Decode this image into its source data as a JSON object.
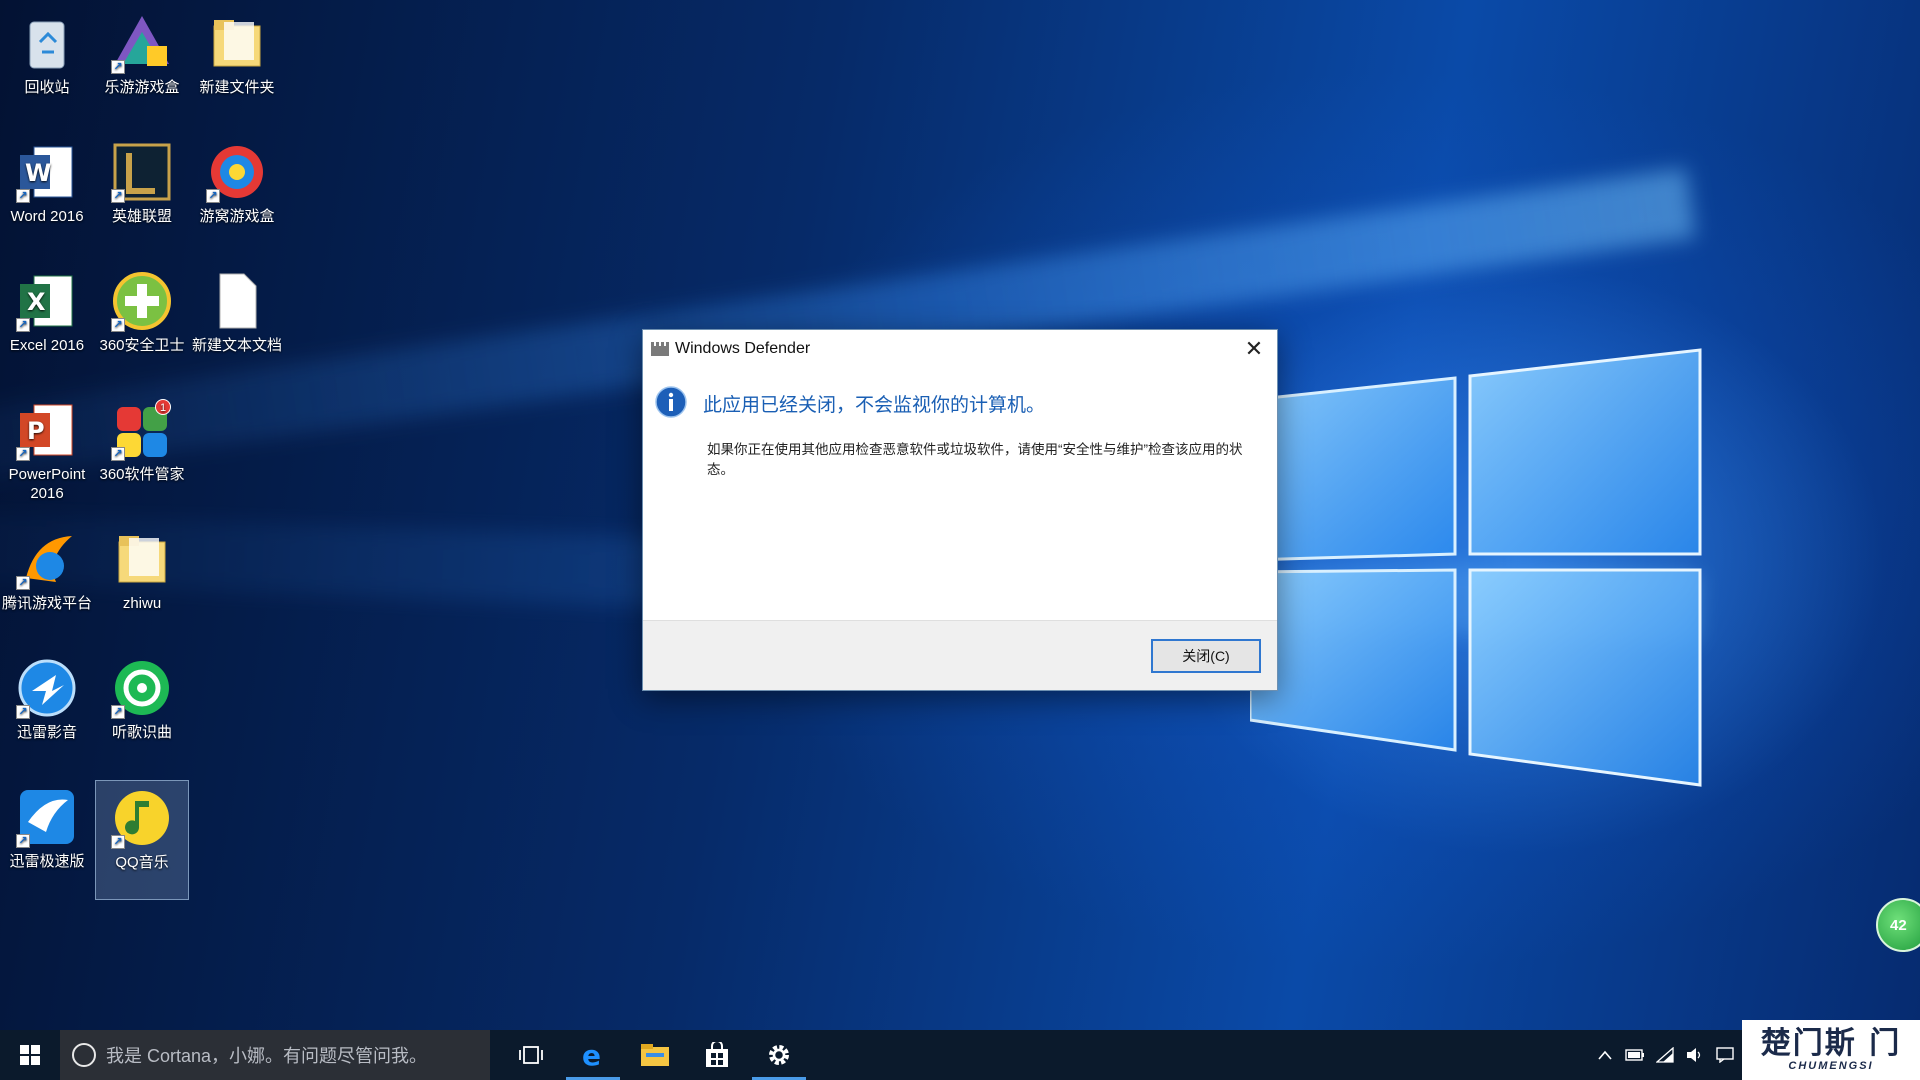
{
  "desktop": {
    "icons": [
      {
        "label": "回收站",
        "icon": "recycle-bin-icon"
      },
      {
        "label": "乐游游戏盒",
        "icon": "leyou-game-box-icon"
      },
      {
        "label": "新建文件夹",
        "icon": "folder-icon"
      },
      {
        "label": "Word 2016",
        "icon": "word-icon"
      },
      {
        "label": "英雄联盟",
        "icon": "league-of-legends-icon"
      },
      {
        "label": "游窝游戏盒",
        "icon": "youwo-game-box-icon"
      },
      {
        "label": "Excel 2016",
        "icon": "excel-icon"
      },
      {
        "label": "360安全卫士",
        "icon": "360-security-icon"
      },
      {
        "label": "新建文本文档",
        "icon": "text-document-icon"
      },
      {
        "label": "PowerPoint 2016",
        "icon": "powerpoint-icon"
      },
      {
        "label": "360软件管家",
        "icon": "360-software-manager-icon",
        "badge": "1"
      },
      {
        "label": "腾讯游戏平台",
        "icon": "tencent-games-icon"
      },
      {
        "label": "zhiwu",
        "icon": "folder-icon"
      },
      {
        "label": "迅雷影音",
        "icon": "xunlei-player-icon"
      },
      {
        "label": "听歌识曲",
        "icon": "song-recognition-icon"
      },
      {
        "label": "迅雷极速版",
        "icon": "xunlei-speed-icon"
      },
      {
        "label": "QQ音乐",
        "icon": "qq-music-icon"
      }
    ]
  },
  "dialog": {
    "title": "Windows Defender",
    "close_glyph": "✕",
    "main_message": "此应用已经关闭，不会监视你的计算机。",
    "sub_message": "如果你正在使用其他应用检查恶意软件或垃圾软件，请使用“安全性与维护”检查该应用的状态。",
    "button_label": "关闭(C)"
  },
  "taskbar": {
    "search_placeholder": "我是 Cortana，小娜。有问题尽管问我。",
    "apps": [
      "task-view-icon",
      "edge-icon",
      "file-explorer-icon",
      "store-icon",
      "settings-icon"
    ],
    "active_app": "settings-icon",
    "tray": [
      "chevron-up-icon",
      "battery-icon",
      "wifi-icon",
      "volume-icon",
      "notification-icon"
    ]
  },
  "side_badge": "42",
  "watermark": {
    "main": "楚门斯 门",
    "sub": "CHUMENGSI"
  }
}
